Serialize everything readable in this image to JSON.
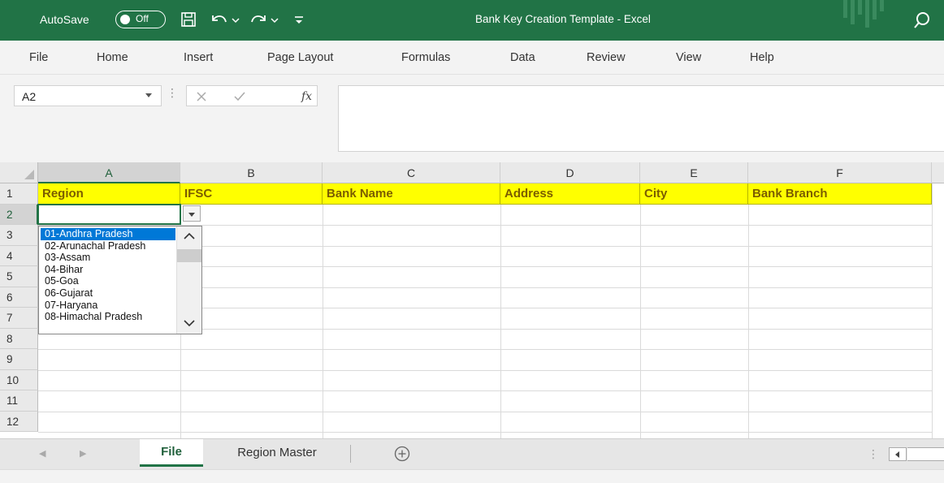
{
  "titlebar": {
    "autosave_label": "AutoSave",
    "autosave_state": "Off",
    "window_title": "Bank Key Creation Template  -  Excel",
    "accent_color": "#217346"
  },
  "menu": {
    "tabs": [
      "File",
      "Home",
      "Insert",
      "Page Layout",
      "Formulas",
      "Data",
      "Review",
      "View",
      "Help"
    ]
  },
  "formula_bar": {
    "name_box_value": "A2",
    "formula_value": ""
  },
  "sheet": {
    "columns": [
      "A",
      "B",
      "C",
      "D",
      "E",
      "F"
    ],
    "rows": [
      "1",
      "2",
      "3",
      "4",
      "5",
      "6",
      "7",
      "8",
      "9",
      "10",
      "11",
      "12"
    ],
    "header_row": [
      "Region",
      "IFSC",
      "Bank Name",
      "Address",
      "City",
      "Bank Branch"
    ],
    "header_fill": "#ffff00",
    "active_cell": "A2"
  },
  "dropdown": {
    "items": [
      "01-Andhra Pradesh",
      "02-Arunachal Pradesh",
      "03-Assam",
      "04-Bihar",
      "05-Goa",
      "06-Gujarat",
      "07-Haryana",
      "08-Himachal Pradesh"
    ],
    "selected_index": 0
  },
  "sheet_tabs": {
    "active": "File",
    "other": "Region Master"
  },
  "icons": {
    "save": "save-icon",
    "undo": "undo-icon",
    "redo": "redo-icon",
    "customize": "customize-toolbar-icon",
    "search": "search-icon",
    "cancel": "cancel-icon",
    "enter": "enter-icon",
    "function": "insert-function-icon",
    "add_sheet": "add-sheet-icon"
  }
}
